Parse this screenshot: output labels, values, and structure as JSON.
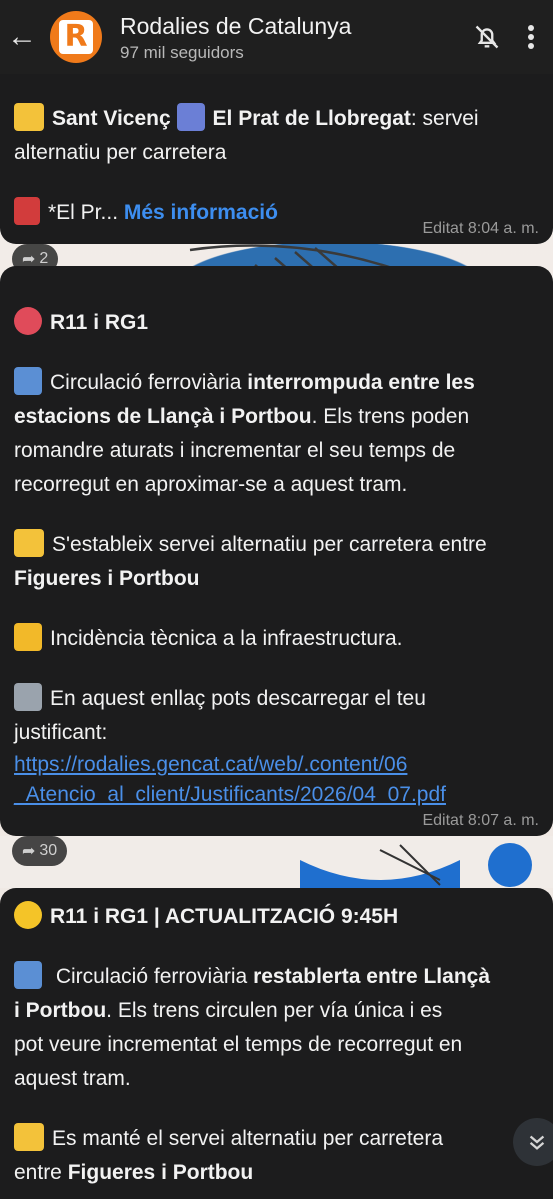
{
  "header": {
    "back_icon": "arrow-left-icon",
    "avatar_letter": "R",
    "title": "Rodalies de Catalunya",
    "subtitle": "97 mil seguidors",
    "mute_icon": "bell-off-icon",
    "menu_icon": "more-vertical-icon"
  },
  "colors": {
    "bubble": "#1c1c1d",
    "header": "#1f1f1f",
    "accent": "#f07a1a",
    "link": "#3d8ef0"
  },
  "messages": [
    {
      "line1_a": "Sant Vicenç",
      "line1_b": "El Prat de Llobregat",
      "line1_c": ": servei",
      "line2": "alternatiu per carretera",
      "line3_a": "*El Pr...",
      "line3_more": "Més informació",
      "edited": "Editat 8:04 a. m.",
      "forwards": "2"
    },
    {
      "title": "R11 i RG1",
      "p1_a": "Circulació ferroviària ",
      "p1_b": "interrompuda entre les",
      "p1_c": "estacions de Llançà i Portbou",
      "p1_d": ". Els trens poden",
      "p1_e": "romandre aturats i incrementar el seu temps de",
      "p1_f": "recorregut en aproximar-se a aquest tram.",
      "p2_a": "S'estableix servei alternatiu per carretera entre",
      "p2_b": "Figueres i Portbou",
      "p3": "Incidència tècnica a la infraestructura.",
      "p4_a": "En aquest enllaç pots descarregar el teu",
      "p4_b": "justificant:",
      "url1": "https://rodalies.gencat.cat/web/.content/06",
      "url2": "_Atencio_al_client/Justificants/2026/04_07.pdf",
      "edited": "Editat 8:07 a. m.",
      "forwards": "30"
    },
    {
      "title": "R11 i RG1 | ACTUALITZACIÓ 9:45H",
      "p1_a": " Circulació ferroviària ",
      "p1_b": "restablerta entre Llançà",
      "p1_c": "i Portbou",
      "p1_d": ". Els trens circulen per vía única i es",
      "p1_e": "pot veure incrementat el temps de recorregut en",
      "p1_f": "aquest tram.",
      "p2_a": "Es manté el servei alternatiu per carretera",
      "p2_b": "entre ",
      "p2_c": "Figueres i Portbou"
    }
  ],
  "scroll_icon": "chevrons-down-icon"
}
